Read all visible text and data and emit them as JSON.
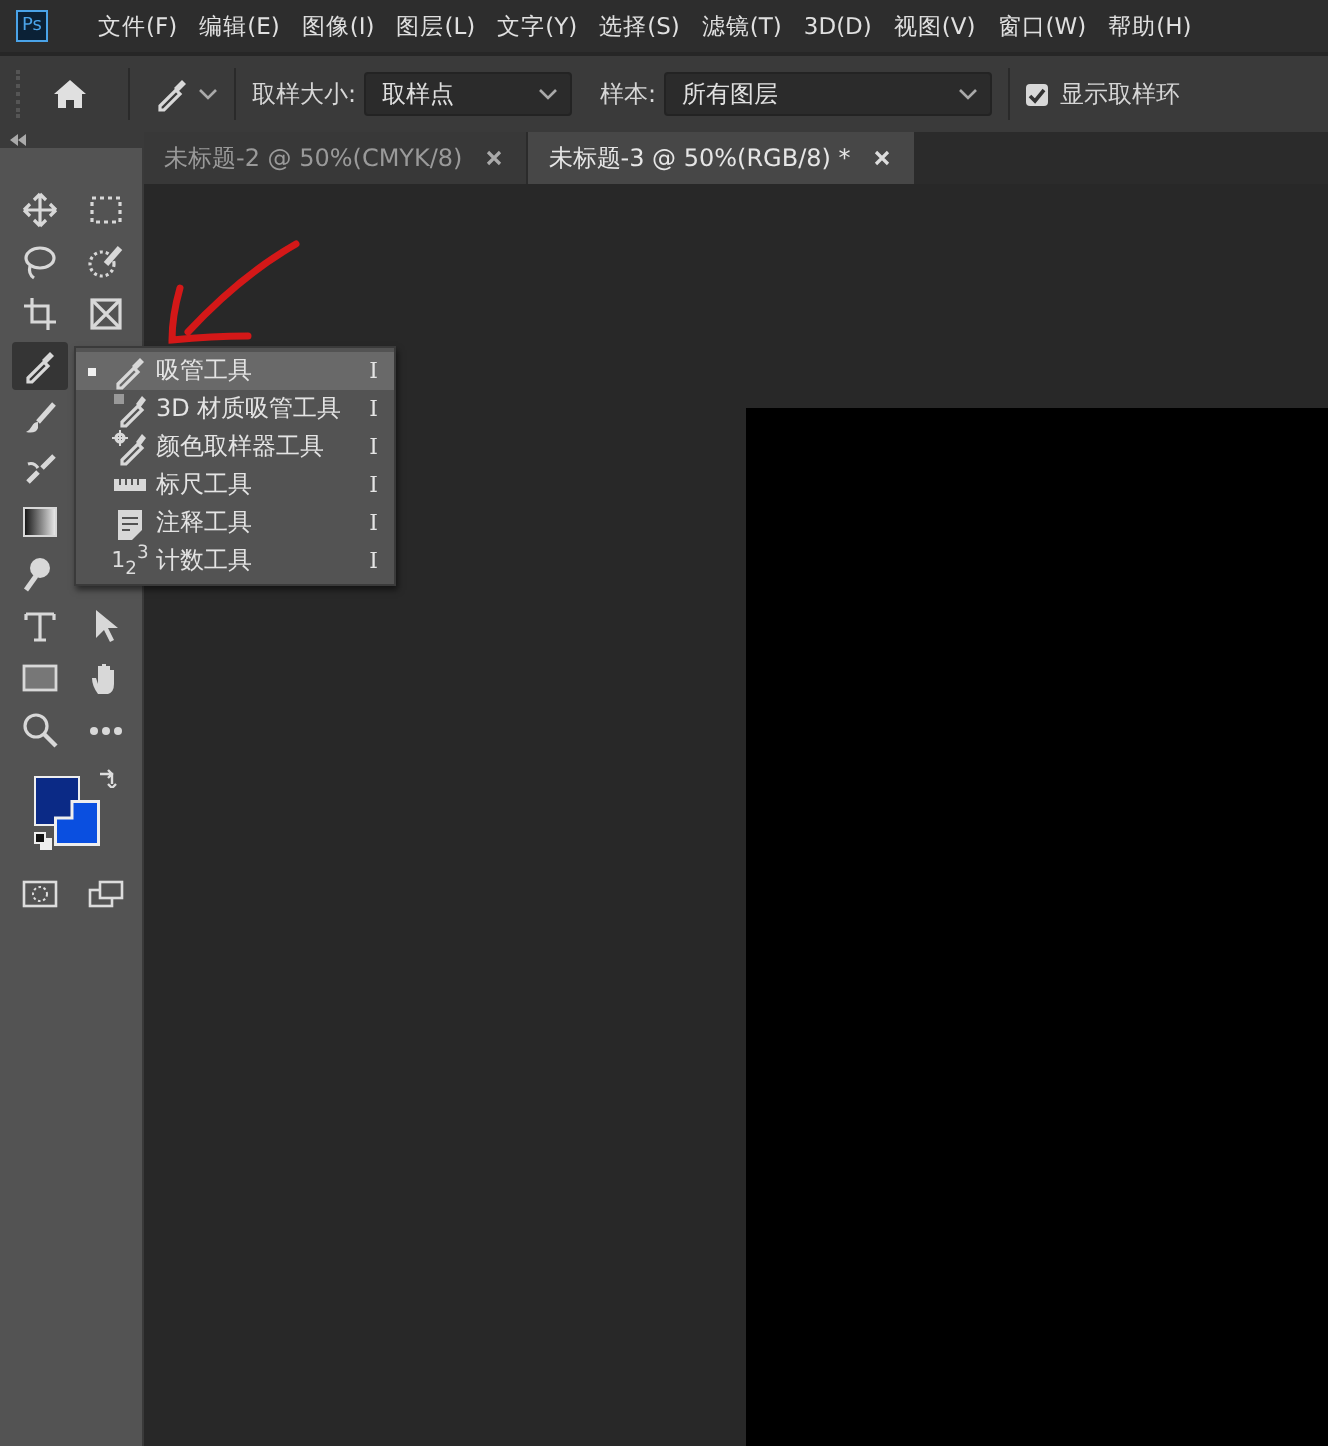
{
  "menubar": {
    "logo": "Ps",
    "items": [
      "文件(F)",
      "编辑(E)",
      "图像(I)",
      "图层(L)",
      "文字(Y)",
      "选择(S)",
      "滤镜(T)",
      "3D(D)",
      "视图(V)",
      "窗口(W)",
      "帮助(H)"
    ]
  },
  "options_bar": {
    "sample_size_label": "取样大小:",
    "sample_size_value": "取样点",
    "sample_label": "样本:",
    "sample_value": "所有图层",
    "show_ring": {
      "label": "显示取样环",
      "checked": true
    }
  },
  "tabs": [
    {
      "label": "未标题-2 @ 50%(CMYK/8)",
      "selected": false
    },
    {
      "label": "未标题-3 @ 50%(RGB/8) *",
      "selected": true
    }
  ],
  "tool_rows": [
    [
      {
        "kind": "move",
        "selected": false
      },
      {
        "kind": "marquee",
        "selected": false
      }
    ],
    [
      {
        "kind": "lasso",
        "selected": false
      },
      {
        "kind": "quick-select",
        "selected": false
      }
    ],
    [
      {
        "kind": "crop",
        "selected": false
      },
      {
        "kind": "frame",
        "selected": false
      }
    ],
    [
      {
        "kind": "eyedropper",
        "selected": true
      }
    ],
    [
      {
        "kind": "brush",
        "selected": false
      }
    ],
    [
      {
        "kind": "stamp",
        "selected": false
      }
    ],
    [
      {
        "kind": "gradient",
        "selected": false
      }
    ],
    [
      {
        "kind": "dodge",
        "selected": false
      }
    ],
    [
      {
        "kind": "type",
        "selected": false
      },
      {
        "kind": "pointer",
        "selected": false
      }
    ],
    [
      {
        "kind": "rectangle",
        "selected": false
      },
      {
        "kind": "hand",
        "selected": false
      }
    ],
    [
      {
        "kind": "zoom",
        "selected": false
      },
      {
        "kind": "more",
        "selected": false
      }
    ]
  ],
  "swatches": [
    {
      "color": "#0b2a86"
    },
    {
      "color": "#0a4fe0"
    }
  ],
  "flyout": [
    {
      "kind": "eyedropper",
      "label": "吸管工具",
      "shortcut": "I",
      "selected": true
    },
    {
      "kind": "material",
      "label": "3D 材质吸管工具",
      "shortcut": "I",
      "selected": false
    },
    {
      "kind": "sampler",
      "label": "颜色取样器工具",
      "shortcut": "I",
      "selected": false
    },
    {
      "kind": "ruler",
      "label": "标尺工具",
      "shortcut": "I",
      "selected": false
    },
    {
      "kind": "note",
      "label": "注释工具",
      "shortcut": "I",
      "selected": false
    },
    {
      "kind": "count",
      "glyph": "1$_{2}$$^{3}$",
      "label": "计数工具",
      "shortcut": "I",
      "selected": false
    }
  ]
}
